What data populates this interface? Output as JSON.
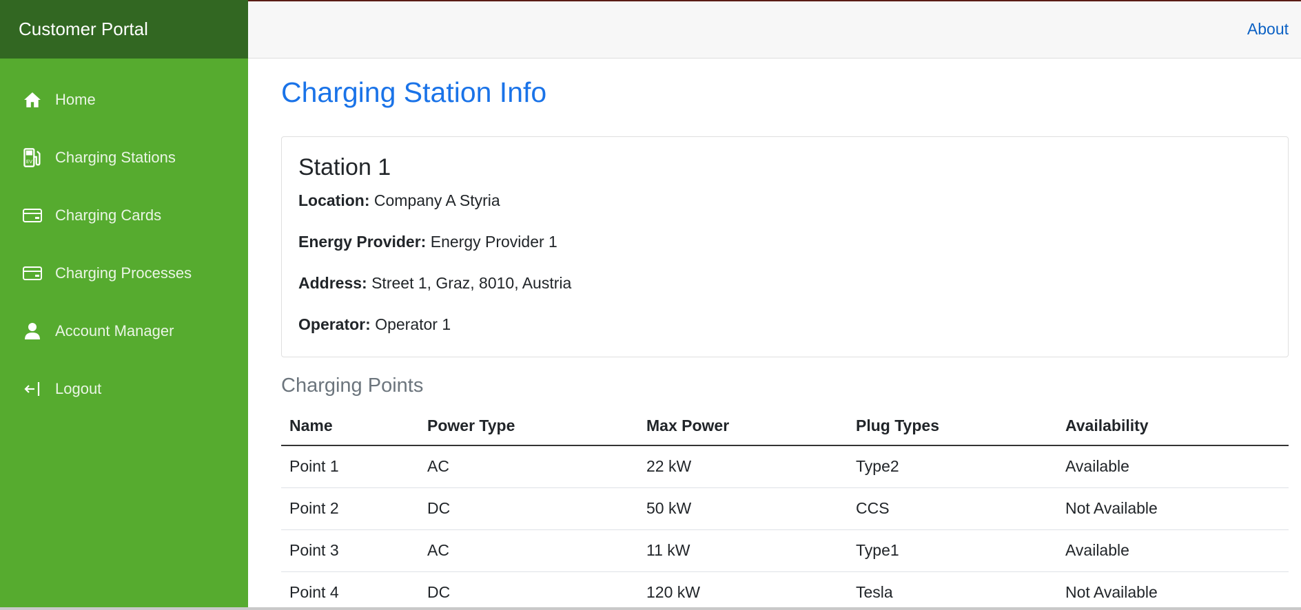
{
  "brand": "Customer Portal",
  "nav": [
    {
      "label": "Home",
      "icon": "home-icon"
    },
    {
      "label": "Charging Stations",
      "icon": "ev-station-icon"
    },
    {
      "label": "Charging Cards",
      "icon": "card-icon"
    },
    {
      "label": "Charging Processes",
      "icon": "card-icon"
    },
    {
      "label": "Account Manager",
      "icon": "user-icon"
    },
    {
      "label": "Logout",
      "icon": "logout-icon"
    }
  ],
  "topbar": {
    "about": "About"
  },
  "page": {
    "title": "Charging Station Info"
  },
  "station": {
    "name": "Station 1",
    "location_label": "Location:",
    "location": "Company A Styria",
    "provider_label": "Energy Provider:",
    "provider": "Energy Provider 1",
    "address_label": "Address:",
    "address": "Street 1, Graz, 8010, Austria",
    "operator_label": "Operator:",
    "operator": "Operator 1"
  },
  "points": {
    "title": "Charging Points",
    "headers": [
      "Name",
      "Power Type",
      "Max Power",
      "Plug Types",
      "Availability"
    ],
    "rows": [
      [
        "Point 1",
        "AC",
        "22 kW",
        "Type2",
        "Available"
      ],
      [
        "Point 2",
        "DC",
        "50 kW",
        "CCS",
        "Not Available"
      ],
      [
        "Point 3",
        "AC",
        "11 kW",
        "Type1",
        "Available"
      ],
      [
        "Point 4",
        "DC",
        "120 kW",
        "Tesla",
        "Not Available"
      ]
    ]
  },
  "colors": {
    "sidebar": "#56ab2f",
    "brand_bg": "#326722",
    "title": "#1a73e8",
    "link": "#0b61c4"
  }
}
